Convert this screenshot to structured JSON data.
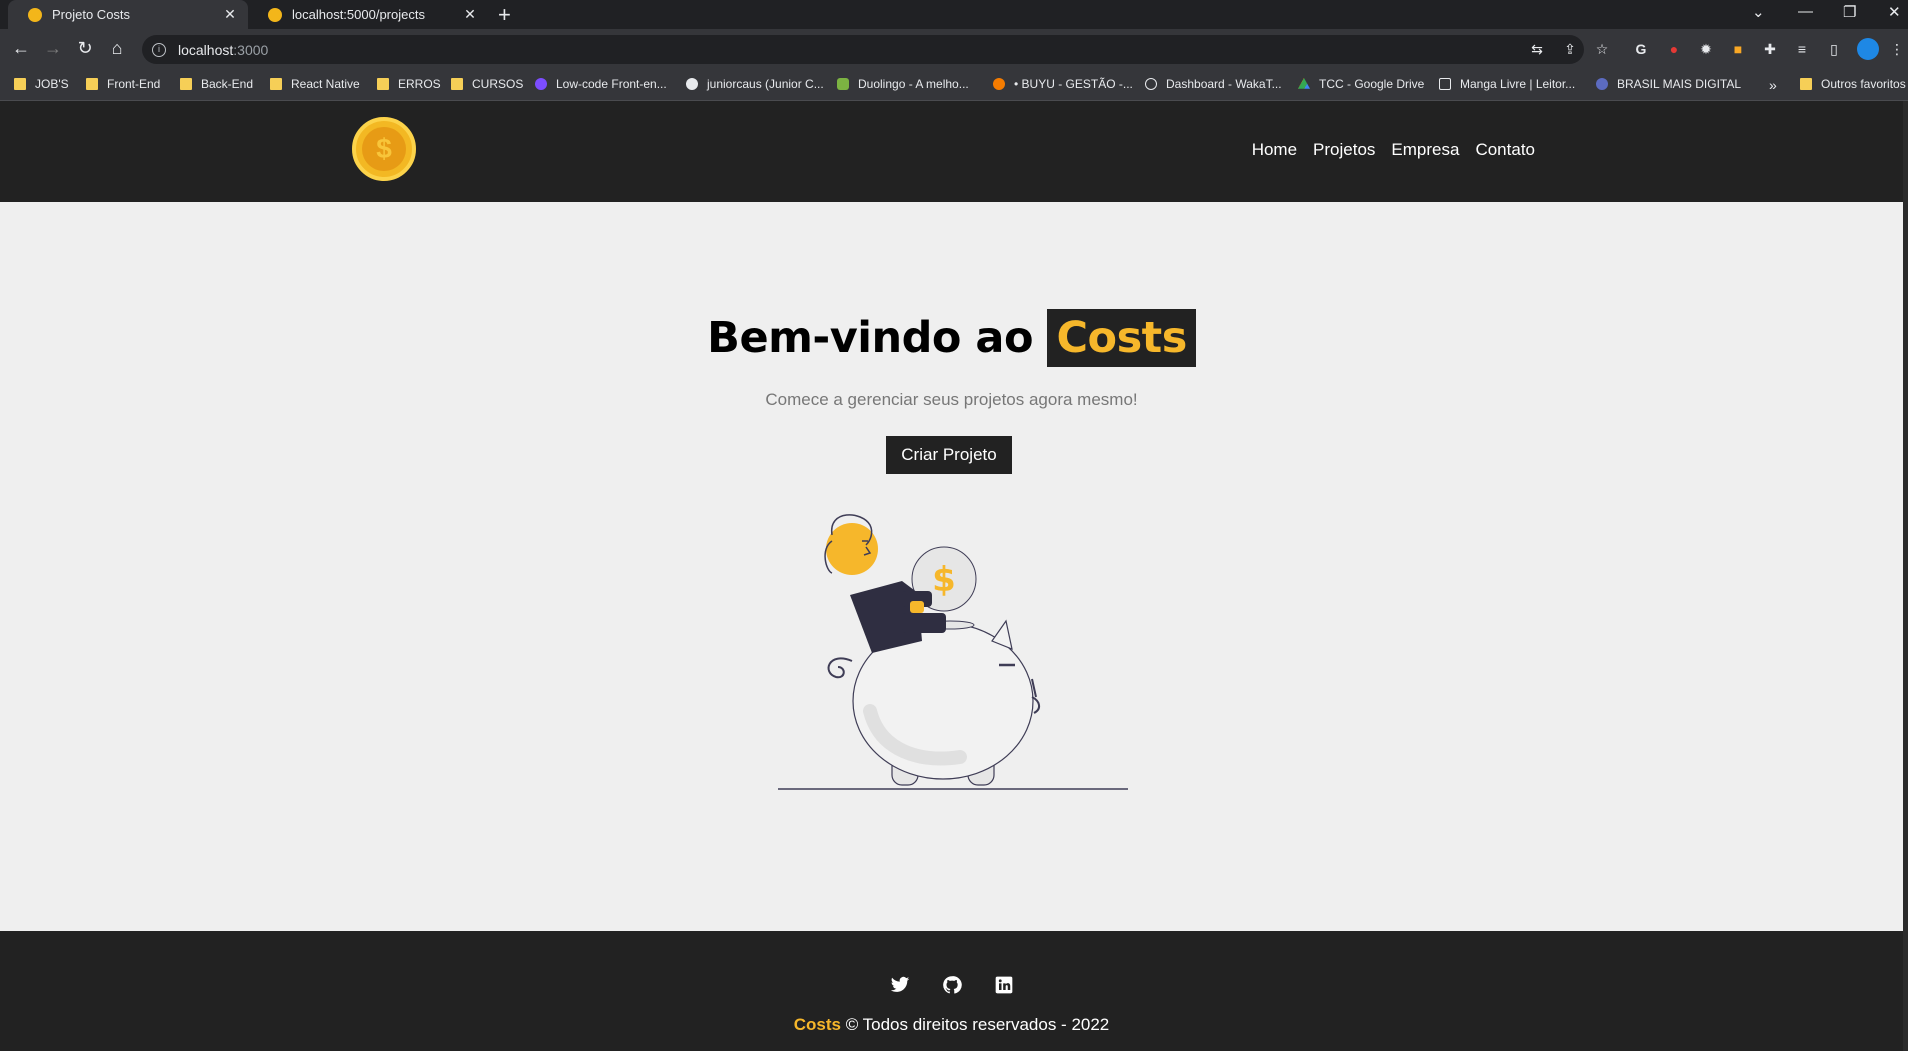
{
  "browser": {
    "tabs": [
      {
        "title": "Projeto Costs",
        "active": true
      },
      {
        "title": "localhost:5000/projects",
        "active": false
      }
    ],
    "url_host": "localhost",
    "url_port": ":3000",
    "bookmarks": [
      {
        "label": "JOB'S",
        "icon": "folder-icon"
      },
      {
        "label": "Front-End",
        "icon": "folder-icon"
      },
      {
        "label": "Back-End",
        "icon": "folder-icon"
      },
      {
        "label": "React Native",
        "icon": "folder-icon"
      },
      {
        "label": "ERROS",
        "icon": "folder-icon"
      },
      {
        "label": "CURSOS",
        "icon": "folder-icon"
      },
      {
        "label": "Low-code Front-en...",
        "icon": "lowcode-icon"
      },
      {
        "label": "juniorcaus (Junior C...",
        "icon": "github-icon"
      },
      {
        "label": "Duolingo - A melho...",
        "icon": "duolingo-icon"
      },
      {
        "label": "• BUYU - GESTÃO -...",
        "icon": "buyu-icon"
      },
      {
        "label": "Dashboard - WakaT...",
        "icon": "wakatime-icon"
      },
      {
        "label": "TCC - Google Drive",
        "icon": "drive-icon"
      },
      {
        "label": "Manga Livre | Leitor...",
        "icon": "manga-icon"
      },
      {
        "label": "BRASIL MAIS DIGITAL",
        "icon": "brasil-icon"
      }
    ],
    "other_bookmarks": "Outros favoritos"
  },
  "site": {
    "nav": {
      "logo_icon": "dollar-coin-icon",
      "links": [
        "Home",
        "Projetos",
        "Empresa",
        "Contato"
      ]
    },
    "hero": {
      "title_prefix": "Bem-vindo ao",
      "title_brand": "Costs",
      "subtitle": "Comece a gerenciar seus projetos agora mesmo!",
      "cta_label": "Criar Projeto",
      "illustration": "piggy-bank-savings-illustration"
    },
    "footer": {
      "social": [
        "twitter-icon",
        "github-icon",
        "linkedin-icon"
      ],
      "brand": "Costs",
      "copyright": "© Todos direitos reservados - 2022"
    },
    "colors": {
      "accent": "#f6b72b",
      "dark": "#222222",
      "background": "#efefef"
    }
  }
}
